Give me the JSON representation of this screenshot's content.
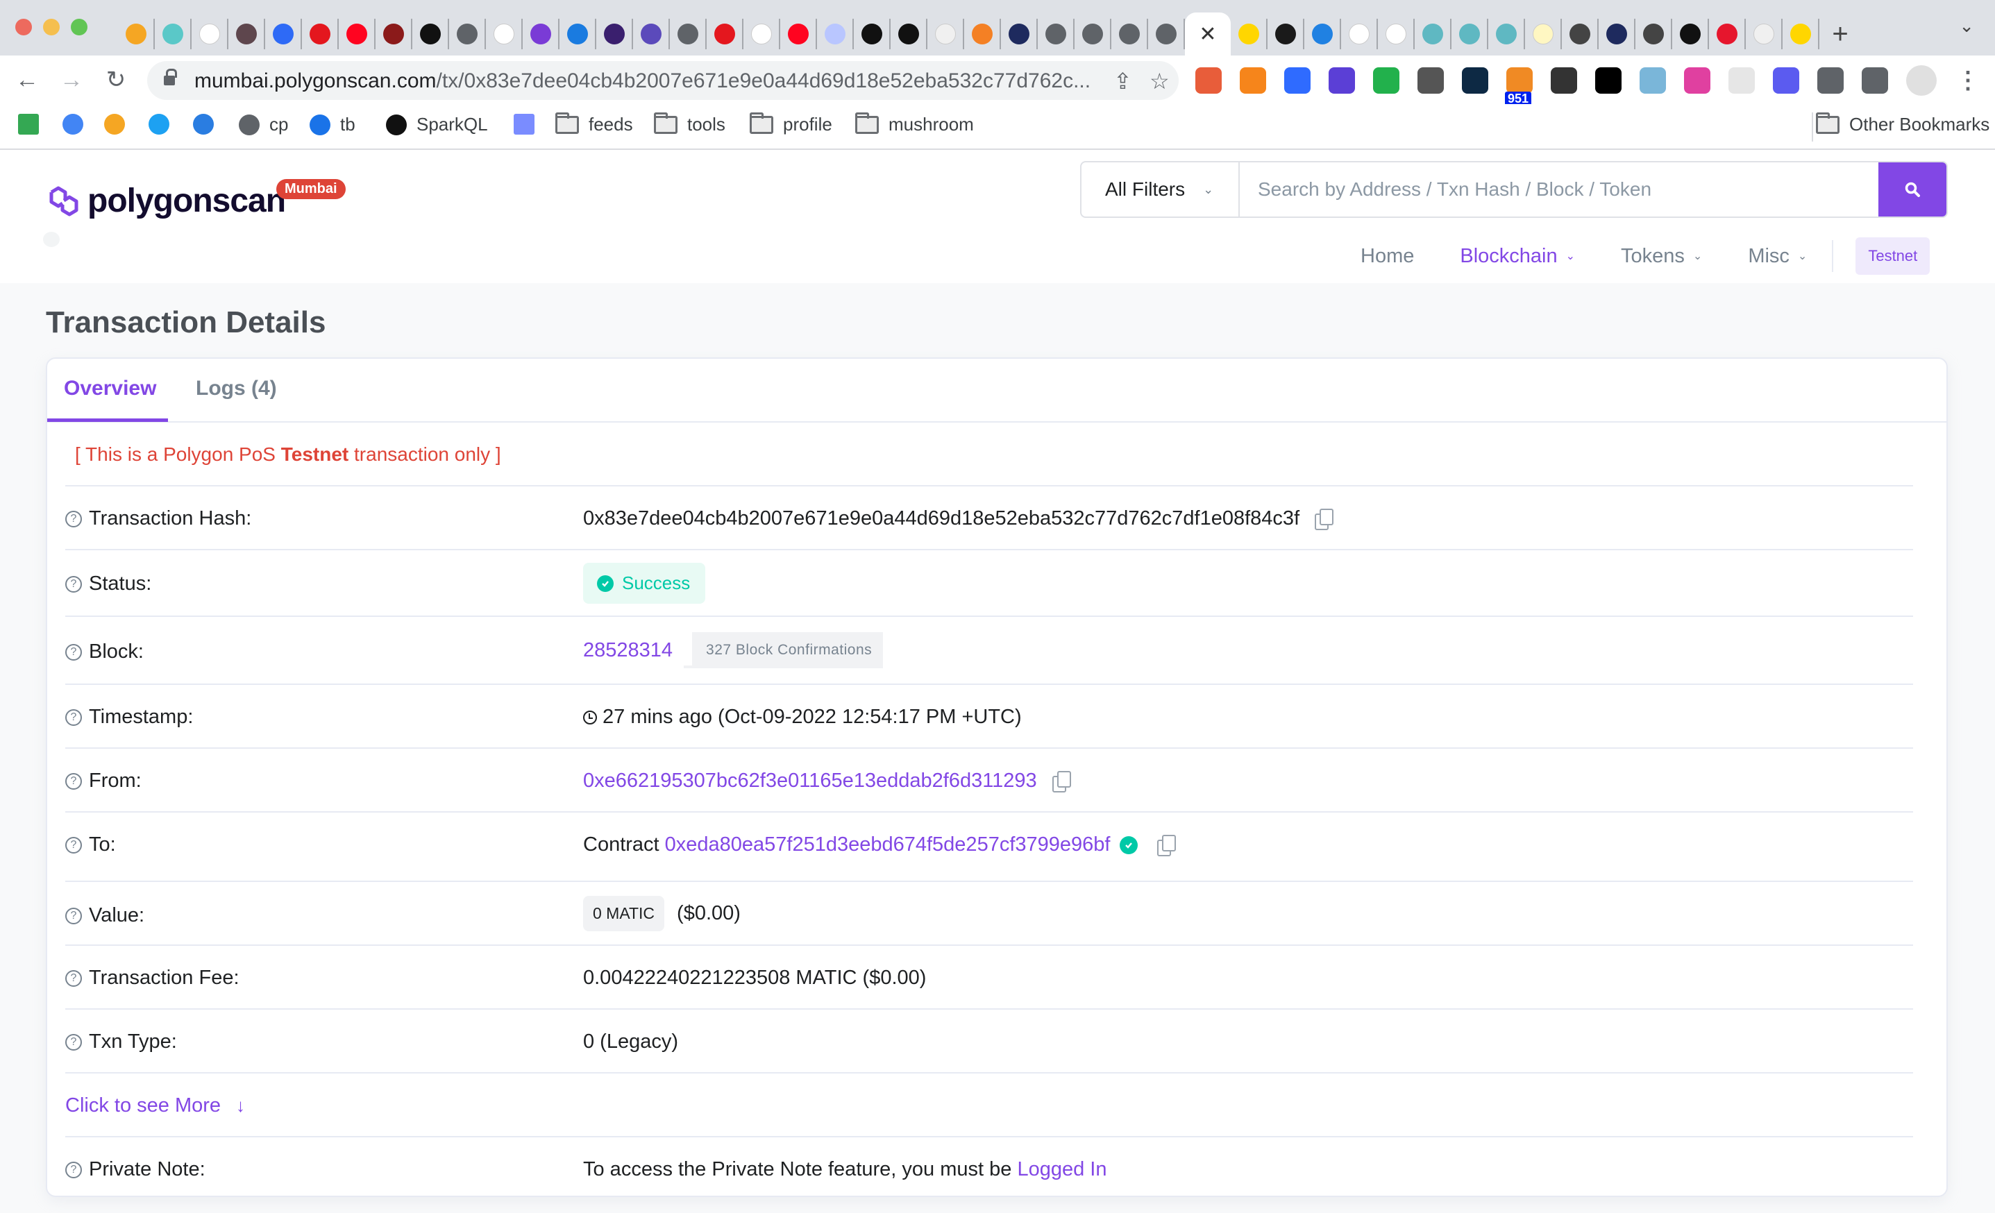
{
  "browser": {
    "active_tab_close": "✕",
    "new_tab": "+",
    "tab_list": "⌄",
    "url_host": "mumbai.polygonscan.com",
    "url_path": "/tx/0x83e7dee04cb4b2007e671e9e0a44d69d18e52eba532c77d762c...",
    "extension_badge": "951",
    "bookmarks": [
      {
        "label": "",
        "icon": "apps-grid-icon"
      },
      {
        "label": "",
        "icon": "google-icon"
      },
      {
        "label": "",
        "icon": "qq-browser-icon"
      },
      {
        "label": "",
        "icon": "twitter-icon"
      },
      {
        "label": "",
        "icon": "blue-app-icon"
      },
      {
        "label": "cp",
        "icon": "globe-icon"
      },
      {
        "label": "tb",
        "icon": "coinmarketcap-icon"
      },
      {
        "label": "SparkQL",
        "icon": "notebook-icon"
      },
      {
        "label": "",
        "icon": "bars-icon"
      },
      {
        "label": "feeds",
        "icon": "folder-icon"
      },
      {
        "label": "tools",
        "icon": "folder-icon"
      },
      {
        "label": "profile",
        "icon": "folder-icon"
      },
      {
        "label": "mushroom",
        "icon": "folder-icon"
      }
    ],
    "other_bookmarks": "Other Bookmarks"
  },
  "header": {
    "logo_text": "polygonscan",
    "network_badge": "Mumbai",
    "search": {
      "filter_label": "All Filters",
      "placeholder": "Search by Address / Txn Hash / Block / Token",
      "value": ""
    },
    "nav": [
      {
        "label": "Home",
        "active": false,
        "has_caret": false
      },
      {
        "label": "Blockchain",
        "active": true,
        "has_caret": true
      },
      {
        "label": "Tokens",
        "active": false,
        "has_caret": true
      },
      {
        "label": "Misc",
        "active": false,
        "has_caret": true
      }
    ],
    "network_button": "Testnet"
  },
  "colors": {
    "accent": "#8247e5",
    "danger": "#de4437",
    "success": "#00c9a7",
    "muted": "#77838f"
  },
  "page": {
    "title": "Transaction Details",
    "tabs": [
      {
        "label": "Overview",
        "active": true
      },
      {
        "label": "Logs (4)",
        "active": false
      }
    ],
    "notice": {
      "prefix": "[ This is a Polygon PoS ",
      "bold": "Testnet",
      "suffix": " transaction only ]"
    },
    "fields": {
      "hash": {
        "label": "Transaction Hash:",
        "value": "0x83e7dee04cb4b2007e671e9e0a44d69d18e52eba532c77d762c7df1e08f84c3f"
      },
      "status": {
        "label": "Status:",
        "value": "Success"
      },
      "block": {
        "label": "Block:",
        "value": "28528314",
        "confirmations": "327 Block Confirmations"
      },
      "timestamp": {
        "label": "Timestamp:",
        "value": "27 mins ago (Oct-09-2022 12:54:17 PM +UTC)"
      },
      "from": {
        "label": "From:",
        "value": "0xe662195307bc62f3e01165e13eddab2f6d311293"
      },
      "to": {
        "label": "To:",
        "prefix": "Contract",
        "value": "0xeda80ea57f251d3eebd674f5de257cf3799e96bf"
      },
      "value": {
        "label": "Value:",
        "amount": "0 MATIC",
        "usd": "($0.00)"
      },
      "fee": {
        "label": "Transaction Fee:",
        "value": "0.00422240221223508 MATIC ($0.00)"
      },
      "txn_type": {
        "label": "Txn Type:",
        "value": "0 (Legacy)"
      },
      "see_more": {
        "label": "Click to see More",
        "arrow": "↓"
      },
      "private_note": {
        "label": "Private Note:",
        "text": "To access the Private Note feature, you must be ",
        "link": "Logged In"
      }
    }
  }
}
